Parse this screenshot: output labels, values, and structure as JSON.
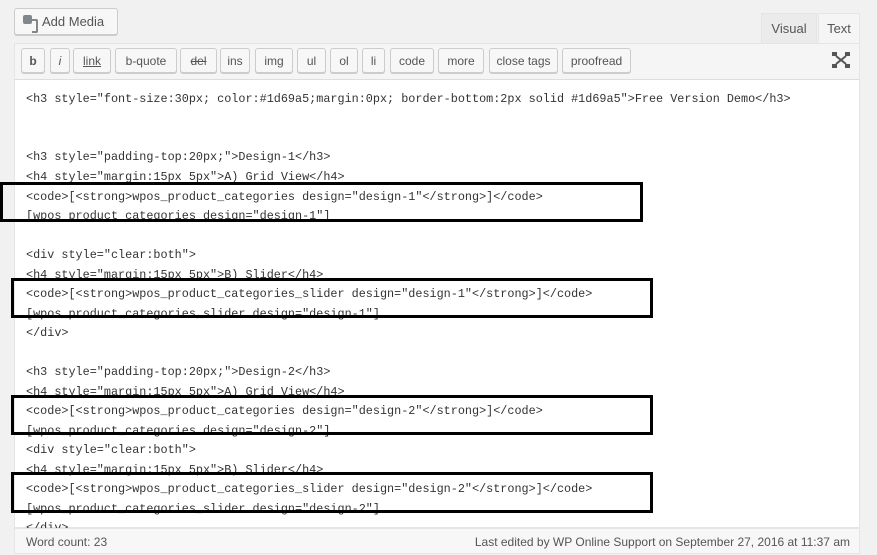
{
  "header": {
    "add_media": "Add Media",
    "tabs": [
      {
        "label": "Visual"
      },
      {
        "label": "Text",
        "active": true
      }
    ]
  },
  "toolbar": {
    "buttons": [
      "b",
      "i",
      "link",
      "b-quote",
      "del",
      "ins",
      "img",
      "ul",
      "ol",
      "li",
      "code",
      "more",
      "close tags",
      "proofread"
    ],
    "fullscreen_icon": "fullscreen-icon"
  },
  "editor": {
    "lines": [
      "<h3 style=\"font-size:30px; color:#1d69a5;margin:0px; border-bottom:2px solid #1d69a5\">Free Version Demo</h3>",
      "",
      "<h3 style=\"padding-top:20px;\">Design-1</h3>",
      "<h4 style=\"margin:15px 5px\">A) Grid View</h4>",
      "<code>[<strong>wpos_product_categories design=\"design-1\"</strong>]</code>",
      "[wpos_product_categories design=\"design-1\"]",
      "",
      "<div style=\"clear:both\">",
      "<h4 style=\"margin:15px 5px\">B) Slider</h4>",
      "<code>[<strong>wpos_product_categories_slider design=\"design-1\"</strong>]</code>",
      "[wpos_product_categories_slider design=\"design-1\"]",
      "</div>",
      "",
      "<h3 style=\"padding-top:20px;\">Design-2</h3>",
      "<h4 style=\"margin:15px 5px\">A) Grid View</h4>",
      "<code>[<strong>wpos_product_categories design=\"design-2\"</strong>]</code>",
      "[wpos_product_categories design=\"design-2\"]",
      "<div style=\"clear:both\">",
      "<h4 style=\"margin:15px 5px\">B) Slider</h4>",
      "<code>[<strong>wpos_product_categories_slider design=\"design-2\"</strong>]</code>",
      "[wpos_product_categories_slider design=\"design-2\"]",
      "</div>"
    ]
  },
  "footer": {
    "word_count": "Word count: 23",
    "last_edited": "Last edited by WP Online Support on September 27, 2016 at 11:37 am"
  }
}
